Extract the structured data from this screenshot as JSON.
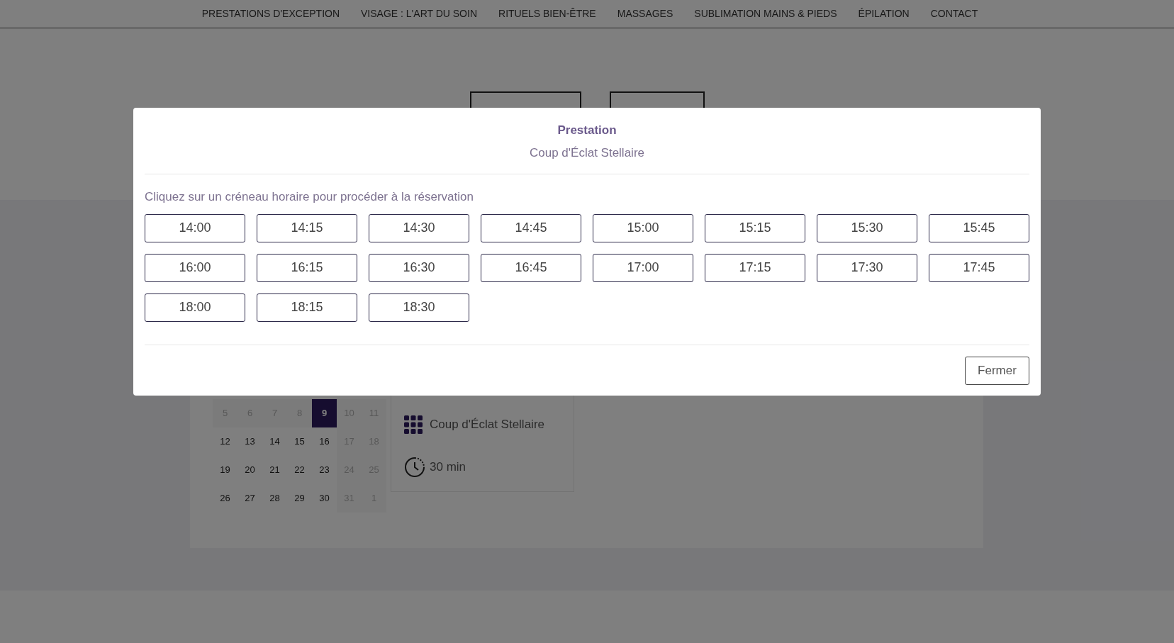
{
  "nav": {
    "items": [
      "PRESTATIONS D'EXCEPTION",
      "VISAGE : L'ART DU SOIN",
      "RITUELS BIEN-ÊTRE",
      "MASSAGES",
      "SUBLIMATION MAINS & PIEDS",
      "ÉPILATION",
      "CONTACT"
    ]
  },
  "calendar": {
    "weeks": [
      [
        {
          "day": "5",
          "disabled": true,
          "selected": false
        },
        {
          "day": "6",
          "disabled": true,
          "selected": false
        },
        {
          "day": "7",
          "disabled": true,
          "selected": false
        },
        {
          "day": "8",
          "disabled": true,
          "selected": false
        },
        {
          "day": "9",
          "disabled": false,
          "selected": true
        },
        {
          "day": "10",
          "disabled": true,
          "selected": false
        },
        {
          "day": "11",
          "disabled": true,
          "selected": false
        }
      ],
      [
        {
          "day": "12",
          "disabled": false,
          "selected": false
        },
        {
          "day": "13",
          "disabled": false,
          "selected": false
        },
        {
          "day": "14",
          "disabled": false,
          "selected": false
        },
        {
          "day": "15",
          "disabled": false,
          "selected": false
        },
        {
          "day": "16",
          "disabled": false,
          "selected": false
        },
        {
          "day": "17",
          "disabled": true,
          "selected": false
        },
        {
          "day": "18",
          "disabled": true,
          "selected": false
        }
      ],
      [
        {
          "day": "19",
          "disabled": false,
          "selected": false
        },
        {
          "day": "20",
          "disabled": false,
          "selected": false
        },
        {
          "day": "21",
          "disabled": false,
          "selected": false
        },
        {
          "day": "22",
          "disabled": false,
          "selected": false
        },
        {
          "day": "23",
          "disabled": false,
          "selected": false
        },
        {
          "day": "24",
          "disabled": true,
          "selected": false
        },
        {
          "day": "25",
          "disabled": true,
          "selected": false
        }
      ],
      [
        {
          "day": "26",
          "disabled": false,
          "selected": false
        },
        {
          "day": "27",
          "disabled": false,
          "selected": false
        },
        {
          "day": "28",
          "disabled": false,
          "selected": false
        },
        {
          "day": "29",
          "disabled": false,
          "selected": false
        },
        {
          "day": "30",
          "disabled": false,
          "selected": false
        },
        {
          "day": "31",
          "disabled": true,
          "selected": false
        },
        {
          "day": "1",
          "disabled": true,
          "selected": false
        }
      ]
    ]
  },
  "summary": {
    "service": "Coup d'Éclat Stellaire",
    "duration": "30 min"
  },
  "modal": {
    "title": "Prestation",
    "subtitle": "Coup d'Éclat Stellaire",
    "instruction": "Cliquez sur un créneau horaire pour procéder à la réservation",
    "slots": [
      "14:00",
      "14:15",
      "14:30",
      "14:45",
      "15:00",
      "15:15",
      "15:30",
      "15:45",
      "16:00",
      "16:15",
      "16:30",
      "16:45",
      "17:00",
      "17:15",
      "17:30",
      "17:45",
      "18:00",
      "18:15",
      "18:30"
    ],
    "close_button": "Fermer"
  }
}
